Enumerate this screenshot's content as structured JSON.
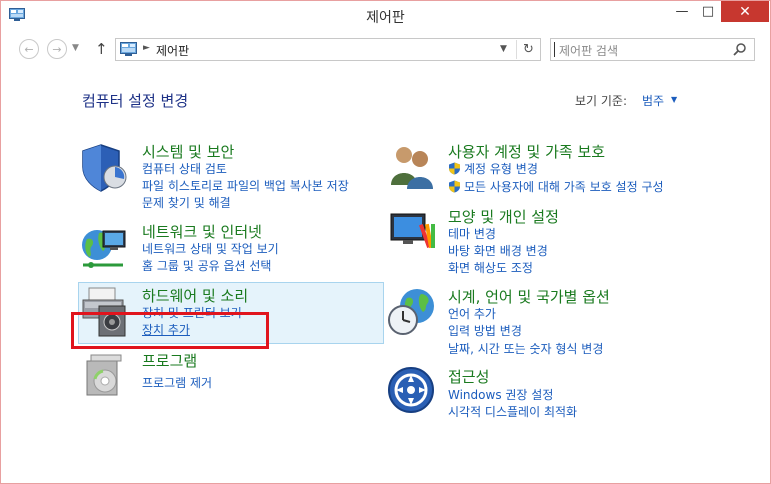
{
  "window": {
    "title": "제어판",
    "minimize": "—",
    "maximize": "□",
    "close": "✕"
  },
  "nav": {
    "back": "←",
    "forward": "→",
    "up": "↑",
    "address_separator": "►",
    "address": "제어판",
    "search_placeholder": "제어판 검색"
  },
  "content": {
    "heading": "컴퓨터 설정 변경",
    "view_by_label": "보기 기준:",
    "view_by_value": "범주"
  },
  "categories": [
    {
      "icon": "shield-icon",
      "title": "시스템 및 보안",
      "links": [
        "컴퓨터 상태 검토",
        "파일 히스토리로 파일의 백업 복사본 저장",
        "문제 찾기 및 해결"
      ]
    },
    {
      "icon": "network-globe-icon",
      "title": "네트워크 및 인터넷",
      "links": [
        "네트워크 상태 및 작업 보기",
        "홈 그룹 및 공유 옵션 선택"
      ]
    },
    {
      "icon": "printer-speaker-icon",
      "title": "하드웨어 및 소리",
      "links": [
        "장치 및 프린터 보기",
        "장치 추가"
      ]
    },
    {
      "icon": "program-box-icon",
      "title": "프로그램",
      "links": [
        "프로그램 제거"
      ]
    },
    {
      "icon": "users-icon",
      "title": "사용자 계정 및 가족 보호",
      "links": [
        "계정 유형 변경",
        "모든 사용자에 대해 가족 보호 설정 구성"
      ]
    },
    {
      "icon": "monitor-palette-icon",
      "title": "모양 및 개인 설정",
      "links": [
        "테마 변경",
        "바탕 화면 배경 변경",
        "화면 해상도 조정"
      ]
    },
    {
      "icon": "clock-globe-icon",
      "title": "시계, 언어 및 국가별 옵션",
      "links": [
        "언어 추가",
        "입력 방법 변경",
        "날짜, 시간 또는 숫자 형식 변경"
      ]
    },
    {
      "icon": "accessibility-icon",
      "title": "접근성",
      "links": [
        "Windows 권장 설정",
        "시각적 디스플레이 최적화"
      ]
    }
  ],
  "colors": {
    "category_title": "#1a7a1f",
    "link": "#1c5dbd",
    "heading": "#1e3287",
    "hover_background": "#e5f3fb",
    "highlight_border": "#e0141d",
    "close_button": "#c7372f"
  }
}
